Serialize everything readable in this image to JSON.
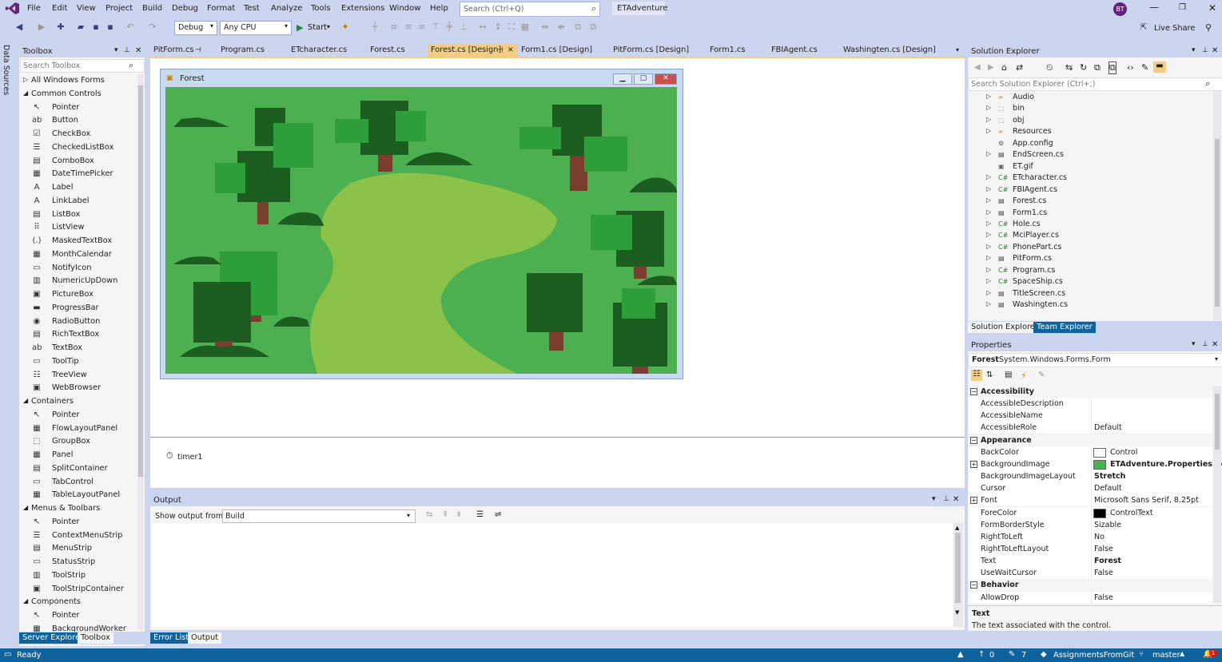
{
  "menubar": {
    "items": [
      "File",
      "Edit",
      "View",
      "Project",
      "Build",
      "Debug",
      "Format",
      "Test",
      "Analyze",
      "Tools",
      "Extensions",
      "Window",
      "Help"
    ],
    "search_placeholder": "Search (Ctrl+Q)",
    "solution_name": "ETAdventure",
    "avatar_initials": "BT",
    "live_share": "Live Share"
  },
  "toolbar": {
    "config": "Debug",
    "platform": "Any CPU",
    "start": "Start"
  },
  "left_strip": {
    "label": "Data Sources"
  },
  "toolbox": {
    "title": "Toolbox",
    "search_placeholder": "Search Toolbox",
    "rows": [
      {
        "kind": "cat",
        "label": "All Windows Forms",
        "tri": "▷",
        "icon": ""
      },
      {
        "kind": "cat",
        "label": "Common Controls",
        "tri": "◢",
        "icon": ""
      },
      {
        "kind": "item",
        "label": "Pointer",
        "icon": "↖"
      },
      {
        "kind": "item",
        "label": "Button",
        "icon": "ab"
      },
      {
        "kind": "item",
        "label": "CheckBox",
        "icon": "☑"
      },
      {
        "kind": "item",
        "label": "CheckedListBox",
        "icon": "☰"
      },
      {
        "kind": "item",
        "label": "ComboBox",
        "icon": "▤"
      },
      {
        "kind": "item",
        "label": "DateTimePicker",
        "icon": "▦"
      },
      {
        "kind": "item",
        "label": "Label",
        "icon": "A"
      },
      {
        "kind": "item",
        "label": "LinkLabel",
        "icon": "A"
      },
      {
        "kind": "item",
        "label": "ListBox",
        "icon": "▤"
      },
      {
        "kind": "item",
        "label": "ListView",
        "icon": "⠿"
      },
      {
        "kind": "item",
        "label": "MaskedTextBox",
        "icon": "(.)"
      },
      {
        "kind": "item",
        "label": "MonthCalendar",
        "icon": "▦"
      },
      {
        "kind": "item",
        "label": "NotifyIcon",
        "icon": "▭"
      },
      {
        "kind": "item",
        "label": "NumericUpDown",
        "icon": "▥"
      },
      {
        "kind": "item",
        "label": "PictureBox",
        "icon": "▣"
      },
      {
        "kind": "item",
        "label": "ProgressBar",
        "icon": "▬"
      },
      {
        "kind": "item",
        "label": "RadioButton",
        "icon": "◉"
      },
      {
        "kind": "item",
        "label": "RichTextBox",
        "icon": "▤"
      },
      {
        "kind": "item",
        "label": "TextBox",
        "icon": "ab"
      },
      {
        "kind": "item",
        "label": "ToolTip",
        "icon": "▭"
      },
      {
        "kind": "item",
        "label": "TreeView",
        "icon": "☷"
      },
      {
        "kind": "item",
        "label": "WebBrowser",
        "icon": "▣"
      },
      {
        "kind": "cat",
        "label": "Containers",
        "tri": "◢",
        "icon": ""
      },
      {
        "kind": "item",
        "label": "Pointer",
        "icon": "↖"
      },
      {
        "kind": "item",
        "label": "FlowLayoutPanel",
        "icon": "▦"
      },
      {
        "kind": "item",
        "label": "GroupBox",
        "icon": "⬚"
      },
      {
        "kind": "item",
        "label": "Panel",
        "icon": "▦"
      },
      {
        "kind": "item",
        "label": "SplitContainer",
        "icon": "▤"
      },
      {
        "kind": "item",
        "label": "TabControl",
        "icon": "▭"
      },
      {
        "kind": "item",
        "label": "TableLayoutPanel",
        "icon": "▦"
      },
      {
        "kind": "cat",
        "label": "Menus & Toolbars",
        "tri": "◢",
        "icon": ""
      },
      {
        "kind": "item",
        "label": "Pointer",
        "icon": "↖"
      },
      {
        "kind": "item",
        "label": "ContextMenuStrip",
        "icon": "☰"
      },
      {
        "kind": "item",
        "label": "MenuStrip",
        "icon": "▤"
      },
      {
        "kind": "item",
        "label": "StatusStrip",
        "icon": "▭"
      },
      {
        "kind": "item",
        "label": "ToolStrip",
        "icon": "▥"
      },
      {
        "kind": "item",
        "label": "ToolStripContainer",
        "icon": "▣"
      },
      {
        "kind": "cat",
        "label": "Components",
        "tri": "◢",
        "icon": ""
      },
      {
        "kind": "item",
        "label": "Pointer",
        "icon": "↖"
      },
      {
        "kind": "item",
        "label": "BackgroundWorker",
        "icon": "▦"
      }
    ],
    "bottom_tabs": [
      "Server Explorer",
      "Toolbox"
    ]
  },
  "doc_tabs": [
    {
      "label": "PitForm.cs",
      "pin": true,
      "active": false
    },
    {
      "label": "Program.cs",
      "pin": false,
      "active": false
    },
    {
      "label": "ETcharacter.cs",
      "pin": false,
      "active": false
    },
    {
      "label": "Forest.cs",
      "pin": false,
      "active": false
    },
    {
      "label": "Forest.cs [Design]",
      "pin": true,
      "active": true
    },
    {
      "label": "Form1.cs [Design]",
      "pin": false,
      "active": false
    },
    {
      "label": "PitForm.cs [Design]",
      "pin": false,
      "active": false
    },
    {
      "label": "Form1.cs",
      "pin": false,
      "active": false
    },
    {
      "label": "FBIAgent.cs",
      "pin": false,
      "active": false
    },
    {
      "label": "Washingten.cs [Design]",
      "pin": false,
      "active": false
    }
  ],
  "designer": {
    "form_title": "Forest",
    "tray_component": "timer1"
  },
  "output": {
    "title": "Output",
    "show_from_label": "Show output from:",
    "show_from_value": "Build",
    "bottom_tabs": [
      "Error List",
      "Output"
    ]
  },
  "solution_explorer": {
    "title": "Solution Explorer",
    "search_placeholder": "Search Solution Explorer (Ctrl+;)",
    "items": [
      {
        "label": "Audio",
        "icon": "folder"
      },
      {
        "label": "bin",
        "icon": "folder-dotted"
      },
      {
        "label": "obj",
        "icon": "folder-dotted"
      },
      {
        "label": "Resources",
        "icon": "folder"
      },
      {
        "label": "App.config",
        "icon": "config"
      },
      {
        "label": "EndScreen.cs",
        "icon": "form"
      },
      {
        "label": "ET.gif",
        "icon": "image"
      },
      {
        "label": "ETcharacter.cs",
        "icon": "cs"
      },
      {
        "label": "FBIAgent.cs",
        "icon": "cs"
      },
      {
        "label": "Forest.cs",
        "icon": "form"
      },
      {
        "label": "Form1.cs",
        "icon": "form"
      },
      {
        "label": "Hole.cs",
        "icon": "cs"
      },
      {
        "label": "MciPlayer.cs",
        "icon": "cs"
      },
      {
        "label": "PhonePart.cs",
        "icon": "cs"
      },
      {
        "label": "PitForm.cs",
        "icon": "form"
      },
      {
        "label": "Program.cs",
        "icon": "cs"
      },
      {
        "label": "SpaceShip.cs",
        "icon": "cs"
      },
      {
        "label": "TitleScreen.cs",
        "icon": "form"
      },
      {
        "label": "Washingten.cs",
        "icon": "form"
      }
    ],
    "bottom_tabs": [
      "Solution Explorer",
      "Team Explorer"
    ]
  },
  "properties": {
    "title": "Properties",
    "object_name": "Forest",
    "object_type": "System.Windows.Forms.Form",
    "rows": [
      {
        "kind": "cat",
        "name": "Accessibility",
        "value": ""
      },
      {
        "kind": "prop",
        "name": "AccessibleDescription",
        "value": ""
      },
      {
        "kind": "prop",
        "name": "AccessibleName",
        "value": ""
      },
      {
        "kind": "prop",
        "name": "AccessibleRole",
        "value": "Default"
      },
      {
        "kind": "cat",
        "name": "Appearance",
        "value": ""
      },
      {
        "kind": "prop",
        "name": "BackColor",
        "value": "Control",
        "swatch": "#ffffff"
      },
      {
        "kind": "prop",
        "name": "BackgroundImage",
        "value": "ETAdventure.Properties.Res",
        "swatch": "#4caf50",
        "bold": true,
        "expand": true
      },
      {
        "kind": "prop",
        "name": "BackgroundImageLayout",
        "value": "Stretch",
        "bold": true
      },
      {
        "kind": "prop",
        "name": "Cursor",
        "value": "Default"
      },
      {
        "kind": "prop",
        "name": "Font",
        "value": "Microsoft Sans Serif, 8.25pt",
        "expand": true
      },
      {
        "kind": "prop",
        "name": "ForeColor",
        "value": "ControlText",
        "swatch": "#000000"
      },
      {
        "kind": "prop",
        "name": "FormBorderStyle",
        "value": "Sizable"
      },
      {
        "kind": "prop",
        "name": "RightToLeft",
        "value": "No"
      },
      {
        "kind": "prop",
        "name": "RightToLeftLayout",
        "value": "False"
      },
      {
        "kind": "prop",
        "name": "Text",
        "value": "Forest",
        "bold": true
      },
      {
        "kind": "prop",
        "name": "UseWaitCursor",
        "value": "False"
      },
      {
        "kind": "cat",
        "name": "Behavior",
        "value": ""
      },
      {
        "kind": "prop",
        "name": "AllowDrop",
        "value": "False"
      }
    ],
    "desc_title": "Text",
    "desc_text": "The text associated with the control."
  },
  "statusbar": {
    "ready": "Ready",
    "up_count": "0",
    "pencil_count": "7",
    "repo": "AssignmentsFromGit",
    "branch": "master",
    "notifications": "1"
  },
  "colors": {
    "accent": "#0e639c",
    "chrome": "#ccd5f0",
    "active_tab": "#f5cc84",
    "grass": "#4caf50",
    "path": "#8bc34a",
    "tree_dark": "#1b5e20",
    "tree_light": "#2e9e3a",
    "trunk": "#7a3e2e"
  }
}
